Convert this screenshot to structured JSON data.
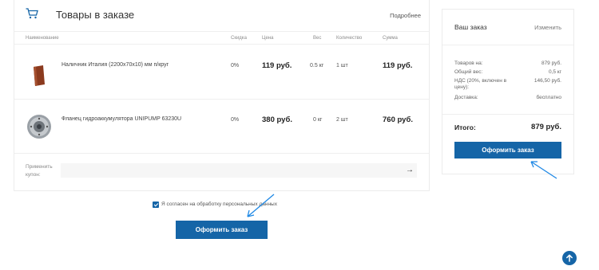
{
  "cart": {
    "title": "Товары в заказе",
    "more_link": "Подробнее",
    "columns": [
      "Наименование",
      "Скидка",
      "Цена",
      "Вес",
      "Количество",
      "Сумма"
    ],
    "items": [
      {
        "name": "Наличник Италия (2200x70x10) мм п/круг",
        "discount": "0%",
        "price": "119 руб.",
        "weight": "0.5 кг",
        "qty": "1 шт",
        "sum": "119 руб."
      },
      {
        "name": "Фланец гидроаккумулятора UNIPUMP 63230U",
        "discount": "0%",
        "price": "380 руб.",
        "weight": "0 кг",
        "qty": "2 шт",
        "sum": "760 руб."
      }
    ],
    "coupon_label": "Применить купон:",
    "coupon_arrow": "→"
  },
  "order": {
    "title": "Ваш заказ",
    "change": "Изменить",
    "goods_label": "Товаров на:",
    "goods_value": "879 руб.",
    "weight_label": "Общий вес:",
    "weight_value": "0,5 кг",
    "vat_label": "НДС (20%, включен в цену):",
    "vat_value": "146,50 руб.",
    "delivery_label": "Доставка:",
    "delivery_value": "бесплатно",
    "total_label": "Итого:",
    "total_value": "879 руб.",
    "submit": "Оформить заказ"
  },
  "agreement": {
    "text": "Я согласен на обработку персональных данных",
    "checked": true
  },
  "main_button": "Оформить заказ",
  "colors": {
    "accent": "#1565a7",
    "arrow": "#1e88e5"
  }
}
